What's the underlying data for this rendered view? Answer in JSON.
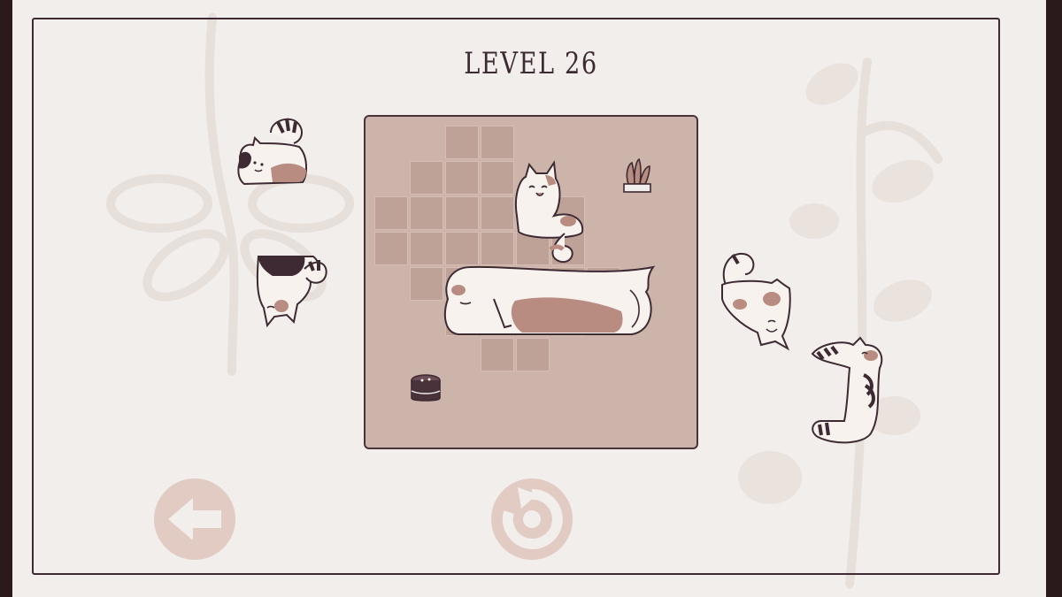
{
  "header": {
    "level_title": "LEVEL 26"
  },
  "board": {
    "rows": 7,
    "cols": 7,
    "open_cells": [
      [
        1,
        3
      ],
      [
        1,
        4
      ],
      [
        2,
        2
      ],
      [
        2,
        3
      ],
      [
        2,
        4
      ],
      [
        3,
        1
      ],
      [
        3,
        2
      ],
      [
        3,
        3
      ],
      [
        3,
        4
      ],
      [
        3,
        5
      ],
      [
        3,
        6
      ],
      [
        4,
        1
      ],
      [
        4,
        2
      ],
      [
        4,
        3
      ],
      [
        4,
        4
      ],
      [
        4,
        5
      ],
      [
        4,
        6
      ],
      [
        5,
        2
      ],
      [
        5,
        3
      ],
      [
        5,
        4
      ],
      [
        5,
        5
      ],
      [
        5,
        6
      ],
      [
        5,
        7
      ],
      [
        6,
        3
      ],
      [
        6,
        4
      ],
      [
        6,
        5
      ],
      [
        6,
        6
      ],
      [
        7,
        4
      ],
      [
        7,
        5
      ]
    ]
  },
  "pieces": [
    {
      "name": "calico-cat-sitting-left",
      "placed": false
    },
    {
      "name": "black-white-cat-curled",
      "placed": false
    },
    {
      "name": "calico-cat-sitting-on-board",
      "placed": true
    },
    {
      "name": "long-loaf-cat-on-board",
      "placed": true
    },
    {
      "name": "calico-cat-curled-right",
      "placed": false
    },
    {
      "name": "striped-cat-stretching-right",
      "placed": false
    }
  ],
  "obstacles": [
    {
      "icon": "potted-plant-icon"
    },
    {
      "icon": "basket-icon"
    }
  ],
  "controls": {
    "back": {
      "icon": "arrow-left-icon"
    },
    "restart": {
      "icon": "restart-icon"
    }
  },
  "colors": {
    "paper": "#f1eeeb",
    "ink": "#3d2a33",
    "board": "#cdb4aa",
    "cell": "#bfa297",
    "button": "#e1cbc3",
    "cat_patch": "#b98c82"
  }
}
